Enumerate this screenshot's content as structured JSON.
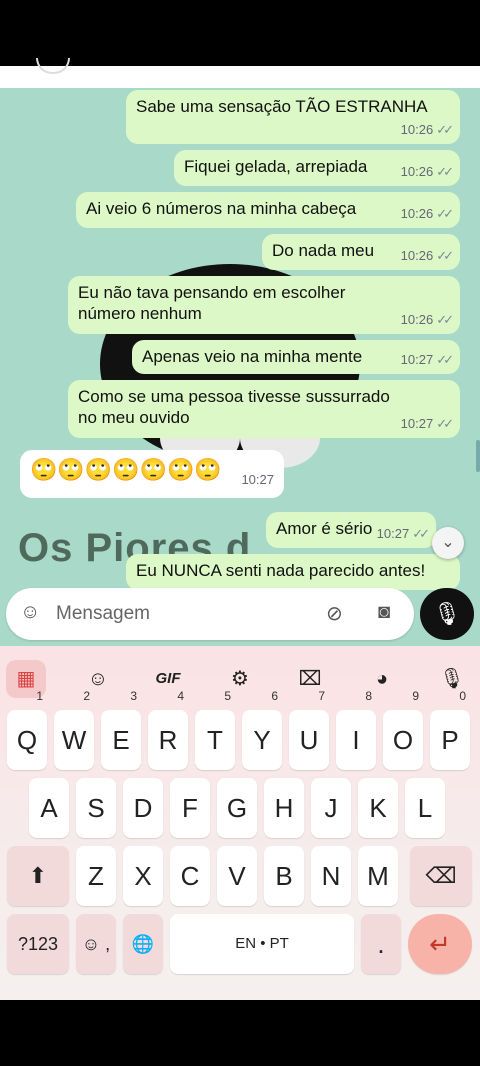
{
  "messages": [
    {
      "dir": "out",
      "text": "Sabe uma sensação TÃO ESTRANHA",
      "time": "10:26",
      "ticks": "✓✓"
    },
    {
      "dir": "out",
      "text": "Fiquei gelada, arrepiada",
      "time": "10:26",
      "ticks": "✓✓"
    },
    {
      "dir": "out",
      "text": "Ai veio 6 números na minha cabeça",
      "time": "10:26",
      "ticks": "✓✓"
    },
    {
      "dir": "out",
      "text": "Do nada meu",
      "time": "10:26",
      "ticks": "✓✓"
    },
    {
      "dir": "out",
      "text": "Eu não tava pensando em escolher número nenhum",
      "time": "10:26",
      "ticks": "✓✓"
    },
    {
      "dir": "out",
      "text": "Apenas veio na minha mente",
      "time": "10:27",
      "ticks": "✓✓"
    },
    {
      "dir": "out",
      "text": "Como se uma pessoa tivesse sussurrado no meu ouvido",
      "time": "10:27",
      "ticks": "✓✓"
    },
    {
      "dir": "in",
      "text": "🙄🙄🙄🙄🙄🙄🙄",
      "time": "10:27"
    },
    {
      "dir": "out",
      "text": "Amor é sério",
      "time": "10:27",
      "ticks": "✓✓"
    },
    {
      "dir": "out",
      "text": "Eu NUNCA senti nada parecido antes!"
    }
  ],
  "wallpaper_text": "Os Piores d",
  "scroll_down_icon": "double-chevron-down-icon",
  "composer": {
    "placeholder": "Mensagem",
    "sticker_icon": "sticker-icon",
    "attach_icon": "paperclip-icon",
    "camera_icon": "camera-icon",
    "mic_icon": "microphone-icon"
  },
  "keyboard": {
    "toolbar": [
      {
        "name": "apps-grid-icon",
        "glyph": "▦"
      },
      {
        "name": "sticker-icon",
        "glyph": "☺"
      },
      {
        "name": "gif-button",
        "glyph": "GIF"
      },
      {
        "name": "settings-gear-icon",
        "glyph": "⚙"
      },
      {
        "name": "translate-icon",
        "glyph": "⌧"
      },
      {
        "name": "palette-icon",
        "glyph": "◕"
      },
      {
        "name": "voice-input-icon",
        "glyph": "🎙"
      }
    ],
    "row1": [
      {
        "key": "Q",
        "hint": "1"
      },
      {
        "key": "W",
        "hint": "2"
      },
      {
        "key": "E",
        "hint": "3"
      },
      {
        "key": "R",
        "hint": "4"
      },
      {
        "key": "T",
        "hint": "5"
      },
      {
        "key": "Y",
        "hint": "6"
      },
      {
        "key": "U",
        "hint": "7"
      },
      {
        "key": "I",
        "hint": "8"
      },
      {
        "key": "O",
        "hint": "9"
      },
      {
        "key": "P",
        "hint": "0"
      }
    ],
    "row2": [
      "A",
      "S",
      "D",
      "F",
      "G",
      "H",
      "J",
      "K",
      "L"
    ],
    "row3": [
      "Z",
      "X",
      "C",
      "V",
      "B",
      "N",
      "M"
    ],
    "shift_glyph": "⬆",
    "backspace_glyph": "⌫",
    "symbols_label": "?123",
    "emoji_comma_label": "☺ ,",
    "globe_glyph": "🌐",
    "space_label": "EN • PT",
    "period_label": ".",
    "enter_glyph": "↵"
  }
}
